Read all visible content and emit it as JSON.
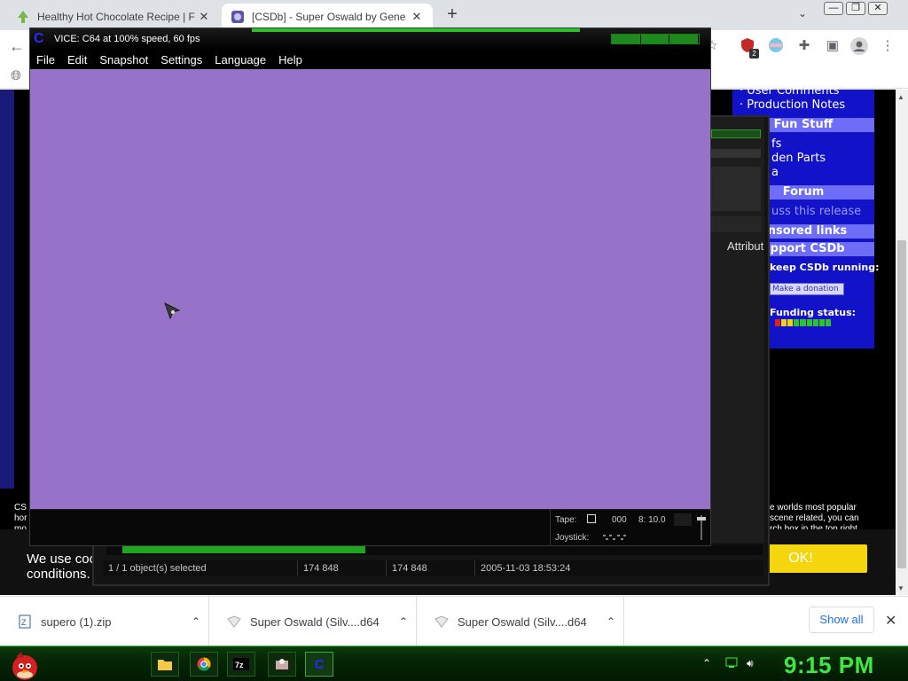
{
  "browser": {
    "tabs": [
      {
        "title": "Healthy Hot Chocolate Recipe | F",
        "favicon": "tree-favicon",
        "active": false
      },
      {
        "title": "[CSDb] - Super Oswald by Gene",
        "favicon": "csdb-favicon",
        "active": true
      }
    ],
    "new_tab": "+",
    "extension_badge": "2",
    "window_controls": [
      "—",
      "❐",
      "✕"
    ]
  },
  "csdb": {
    "links_top": [
      "· User Comments",
      "· Production Notes"
    ],
    "headers": [
      "Fun Stuff",
      "Forum",
      "onsored links",
      "upport CSDb"
    ],
    "fun_links": [
      "fs",
      "den Parts",
      "a"
    ],
    "forum_link": "uss this release",
    "keep_text": "keep CSDb running:",
    "donate_label": "Make a donation",
    "funding_label": "Funding status:",
    "footer_right": "e worlds most popular\nscene related, you can\nrch box in the top right",
    "footer_left": "CS\nhor\nmo"
  },
  "cookie": {
    "text": "We use coo\nconditions.",
    "ok_label": "OK!"
  },
  "explorer": {
    "attrib_label": "Attribut",
    "status": [
      "1 / 1 object(s) selected",
      "174 848",
      "174 848",
      "2005-11-03 18:53:24"
    ],
    "progress": 0.38
  },
  "vice": {
    "title": "VICE: C64 at 100% speed, 60 fps",
    "menu": [
      "File",
      "Edit",
      "Snapshot",
      "Settings",
      "Language",
      "Help"
    ],
    "screen_color": "#9673c8",
    "tape_label": "Tape:",
    "tape_counter": "000",
    "drive_label": "8: 10.0",
    "joystick_label": "Joystick:"
  },
  "downloads": {
    "items": [
      {
        "name": "supero (1).zip",
        "icon": "zip-icon"
      },
      {
        "name": "Super Oswald (Silv....d64",
        "icon": "file-icon"
      },
      {
        "name": "Super Oswald (Silv....d64",
        "icon": "file-icon"
      }
    ],
    "show_all": "Show all"
  },
  "taskbar": {
    "time": "9:15 PM"
  }
}
